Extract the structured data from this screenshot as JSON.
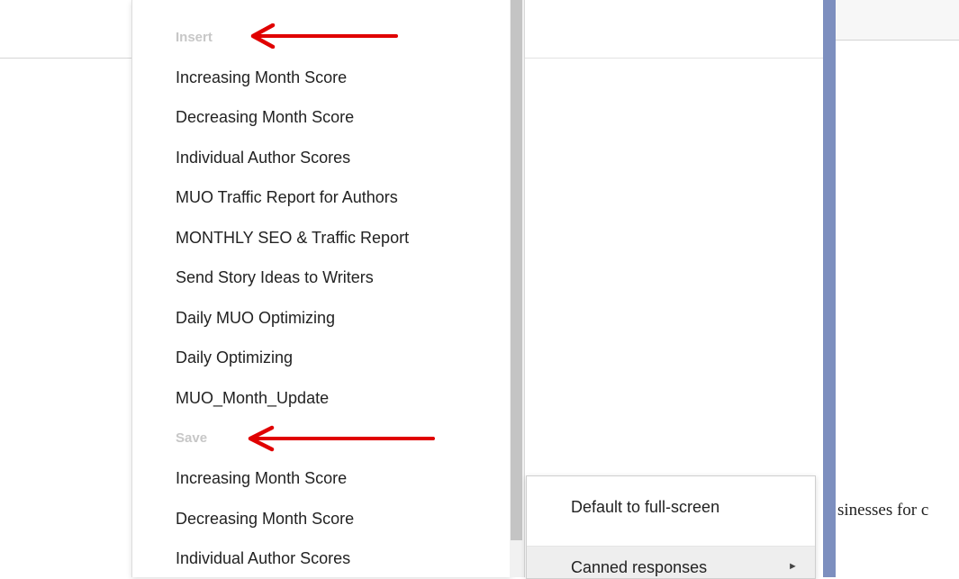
{
  "background": {
    "body_text": "sinesses for c"
  },
  "canned_menu": {
    "insert": {
      "label": "Insert",
      "items": [
        "Increasing Month Score",
        "Decreasing Month Score",
        "Individual Author Scores",
        "MUO Traffic Report for Authors",
        "MONTHLY SEO & Traffic Report",
        "Send Story Ideas to Writers",
        "Daily MUO Optimizing",
        "Daily Optimizing",
        "MUO_Month_Update"
      ]
    },
    "save": {
      "label": "Save",
      "items": [
        "Increasing Month Score",
        "Decreasing Month Score",
        "Individual Author Scores"
      ]
    }
  },
  "settings_menu": {
    "full_screen": "Default to full-screen",
    "canned_responses": "Canned responses",
    "submenu_icon": "triangle-right-icon"
  },
  "annotations": {
    "arrow_color": "#e00000",
    "arrow_icon": "left-arrow-icon"
  },
  "colors": {
    "compose_border": "#7d8fbf",
    "section_label": "#c7c7c7",
    "highlight": "#eeeeee"
  }
}
